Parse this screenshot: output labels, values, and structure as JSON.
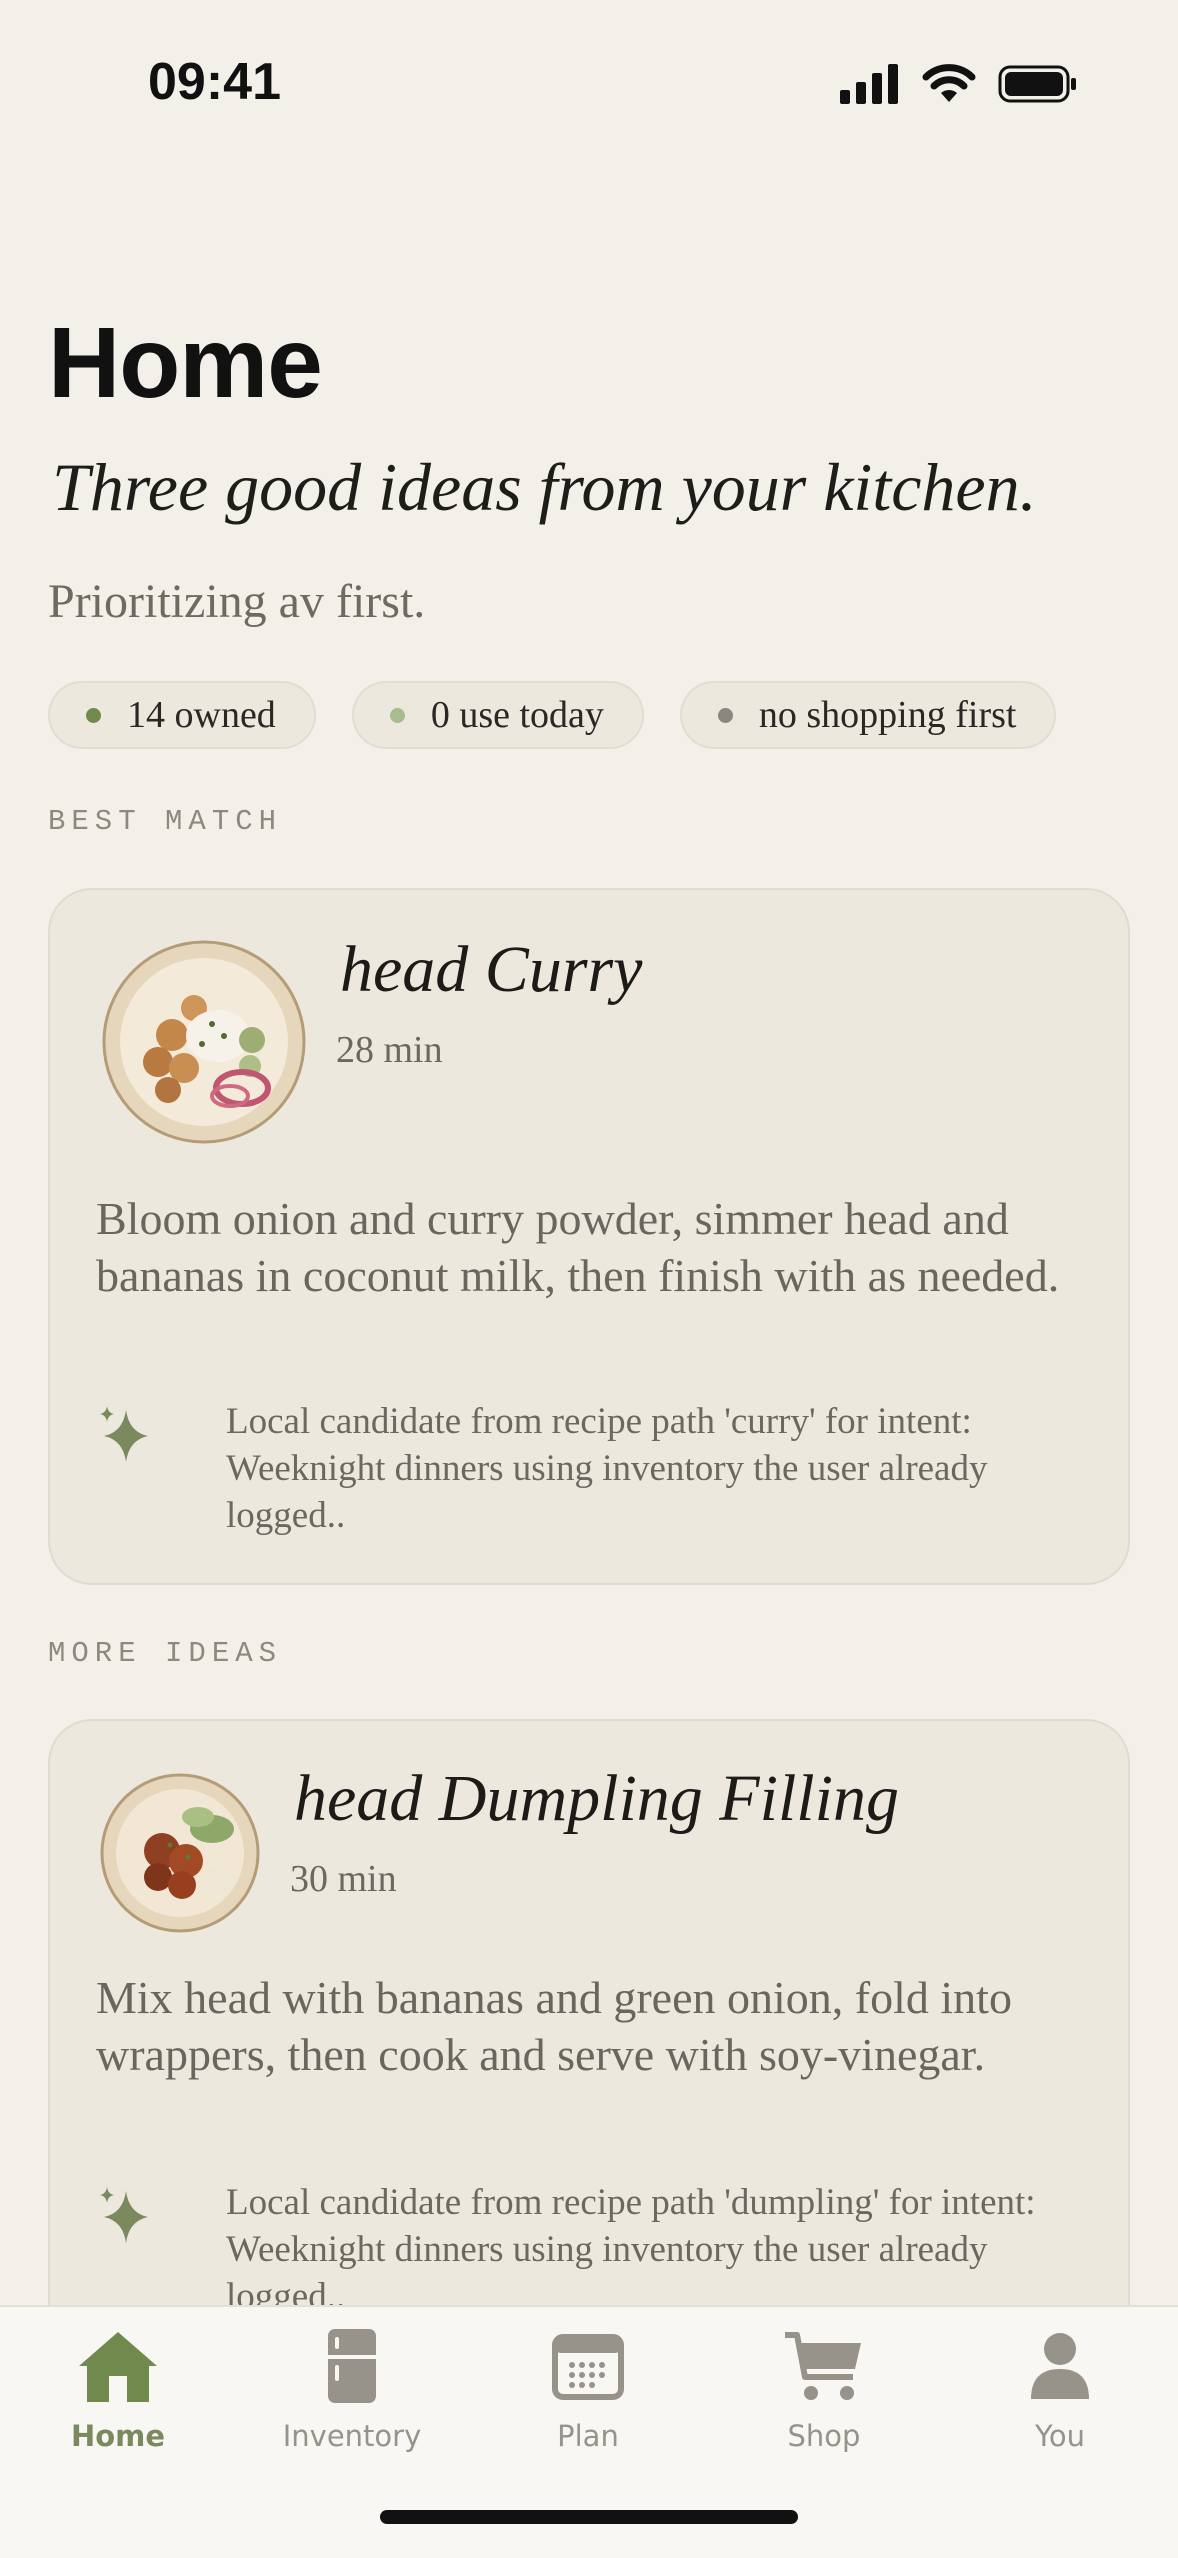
{
  "status_bar": {
    "time": "09:41"
  },
  "header": {
    "title": "Home",
    "tagline": "Three good ideas from your kitchen.",
    "priority": "Prioritizing av first."
  },
  "chips": [
    {
      "label": "14 owned",
      "dot_color": "#6f8a4c"
    },
    {
      "label": "0 use today",
      "dot_color": "#a9bc8e"
    },
    {
      "label": "no shopping first",
      "dot_color": "#8b877e"
    }
  ],
  "sections": {
    "best_match": "BEST MATCH",
    "more_ideas": "MORE IDEAS"
  },
  "best_match": {
    "name": "head Curry",
    "time": "28 min",
    "description": "Bloom onion and curry powder, simmer head and bananas in coconut milk, then finish with as needed.",
    "reason": "Local candidate from recipe path 'curry' for intent: Weeknight dinners using inventory the user already logged.."
  },
  "more_ideas": [
    {
      "name": "head Dumpling Filling",
      "time": "30 min",
      "description": "Mix head with bananas and green onion, fold into wrappers, then cook and serve with soy-vinegar.",
      "reason": "Local candidate from recipe path 'dumpling' for intent: Weeknight dinners using inventory the user already logged.."
    }
  ],
  "tabs": [
    {
      "label": "Home",
      "icon": "house-icon",
      "active": true
    },
    {
      "label": "Inventory",
      "icon": "fridge-icon",
      "active": false
    },
    {
      "label": "Plan",
      "icon": "calendar-icon",
      "active": false
    },
    {
      "label": "Shop",
      "icon": "cart-icon",
      "active": false
    },
    {
      "label": "You",
      "icon": "person-icon",
      "active": false
    }
  ],
  "colors": {
    "accent": "#6f8a4c",
    "background": "#f3f0e9",
    "card": "#ece8de"
  }
}
